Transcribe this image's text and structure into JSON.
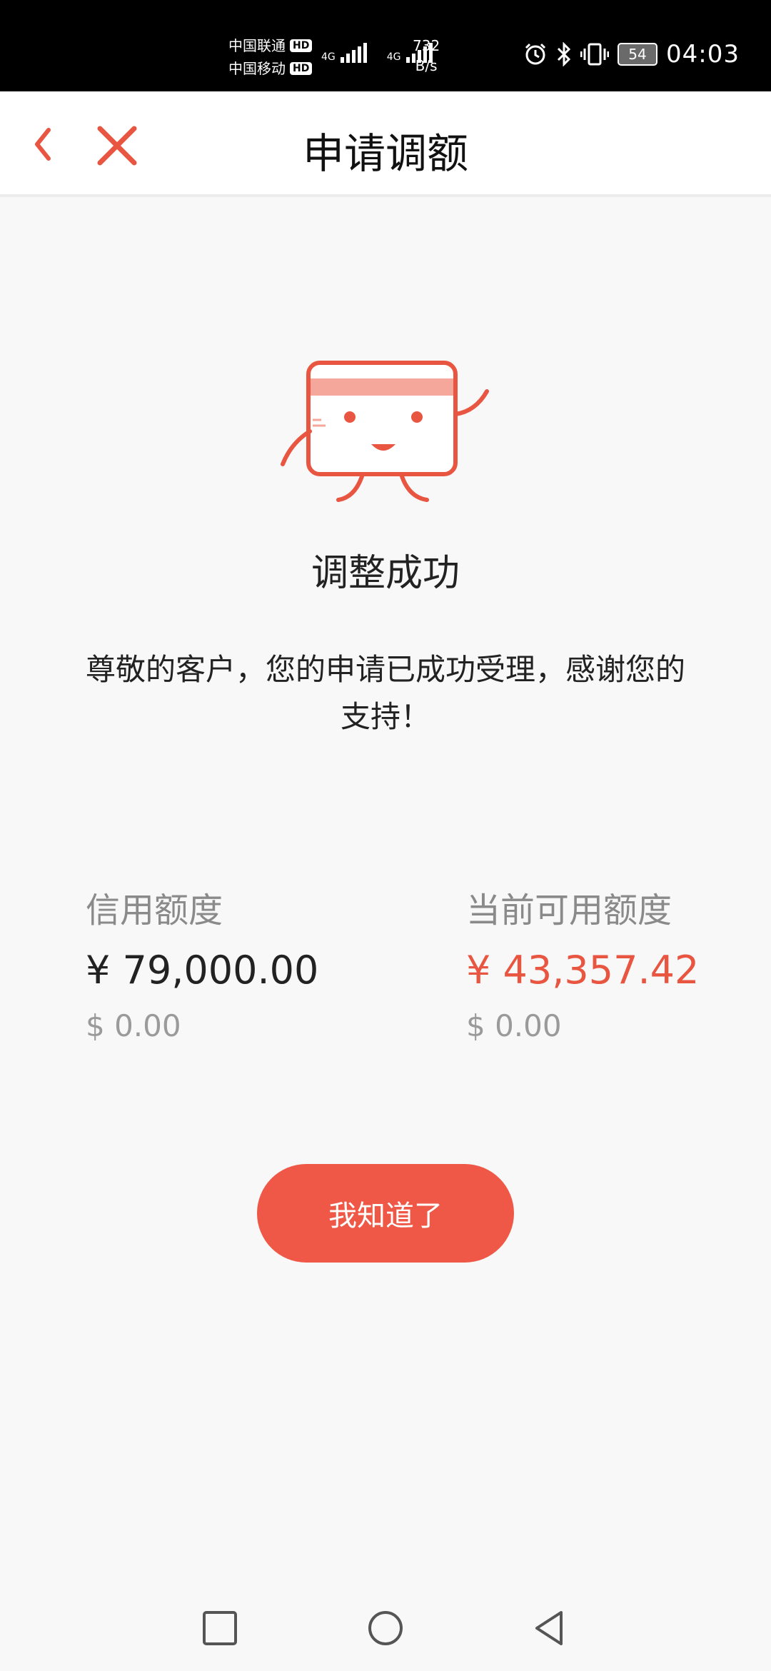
{
  "status_bar": {
    "carrier_1": "中国联通",
    "carrier_2": "中国移动",
    "hd_badge": "HD",
    "network_type": "4G",
    "speed_value": "732",
    "speed_unit": "B/s",
    "battery_level": "54",
    "time": "04:03",
    "icons": [
      "alarm-icon",
      "bluetooth-icon",
      "vibrate-icon",
      "battery-icon"
    ]
  },
  "navbar": {
    "title": "申请调额",
    "back_icon": "chevron-left-icon",
    "close_icon": "close-icon",
    "accent_color": "#e85541"
  },
  "result": {
    "mascot_icon": "card-mascot-icon",
    "title": "调整成功",
    "description": "尊敬的客户，您的申请已成功受理，感谢您的支持！"
  },
  "limits": {
    "credit": {
      "label": "信用额度",
      "cny": "¥ 79,000.00",
      "usd": "$ 0.00"
    },
    "available": {
      "label": "当前可用额度",
      "cny": "¥ 43,357.42",
      "usd": "$ 0.00"
    }
  },
  "actions": {
    "confirm_label": "我知道了",
    "button_color": "#ef5846"
  },
  "system_nav": {
    "icons": [
      "recent-apps-icon",
      "home-icon",
      "back-triangle-icon"
    ]
  }
}
